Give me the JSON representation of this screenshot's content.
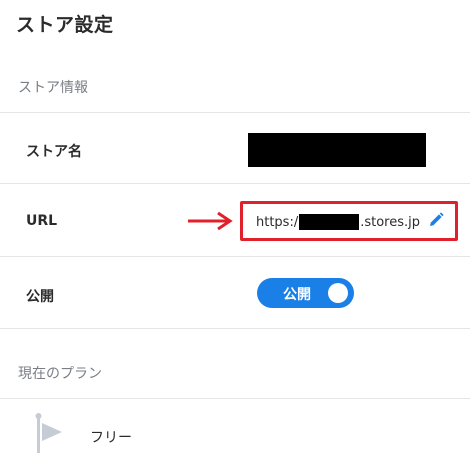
{
  "page": {
    "title": "ストア設定"
  },
  "store_info": {
    "section_title": "ストア情報",
    "store_name_label": "ストア名",
    "url_label": "URL",
    "url_prefix": "https:/",
    "url_suffix": ".stores.jp",
    "visibility_label": "公開",
    "visibility_toggle_text": "公開",
    "visibility_on": true
  },
  "plan": {
    "section_title": "現在のプラン",
    "name": "フリー"
  },
  "colors": {
    "accent": "#1a7fe6",
    "highlight_red": "#e0202a",
    "muted_text": "#7a7f86",
    "divider": "#e4e6e8"
  },
  "icons": {
    "edit": "pencil-icon",
    "arrow": "right-arrow-icon",
    "plan": "flag-icon"
  }
}
